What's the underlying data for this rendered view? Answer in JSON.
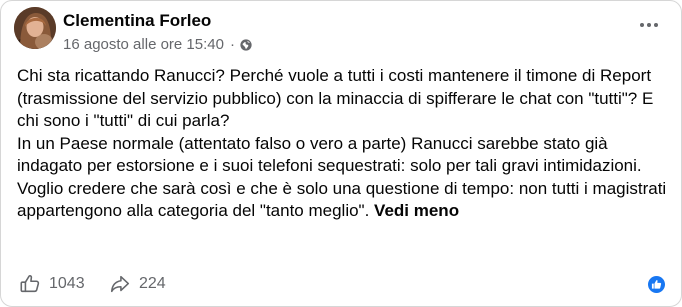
{
  "post": {
    "author": "Clementina Forleo",
    "timestamp": "16 agosto alle ore 15:40",
    "separator": "·",
    "audience_icon": "globe-icon",
    "more_icon": "more-options-icon",
    "paragraphs": [
      "Chi sta ricattando Ranucci? Perché vuole a tutti i costi mantenere il timone di Report (trasmissione del servizio pubblico) con la minaccia di spifferare le chat con \"tutti\"? E chi sono i \"tutti\" di cui parla?",
      "In un Paese normale (attentato falso o vero a parte)  Ranucci sarebbe stato già indagato per estorsione e i suoi telefoni sequestrati: solo per tali gravi intimidazioni.",
      "Voglio credere che sarà così e che è solo una questione di tempo: non tutti i magistrati appartengono alla categoria del \"tanto meglio\"."
    ],
    "see_less": "Vedi meno"
  },
  "footer": {
    "likes": "1043",
    "shares": "224",
    "like_icon": "thumbs-up-icon",
    "share_icon": "share-arrow-icon",
    "reaction_icon": "like-reaction-icon"
  },
  "colors": {
    "text": "#050505",
    "secondary": "#65676b",
    "accent": "#1877f2"
  }
}
